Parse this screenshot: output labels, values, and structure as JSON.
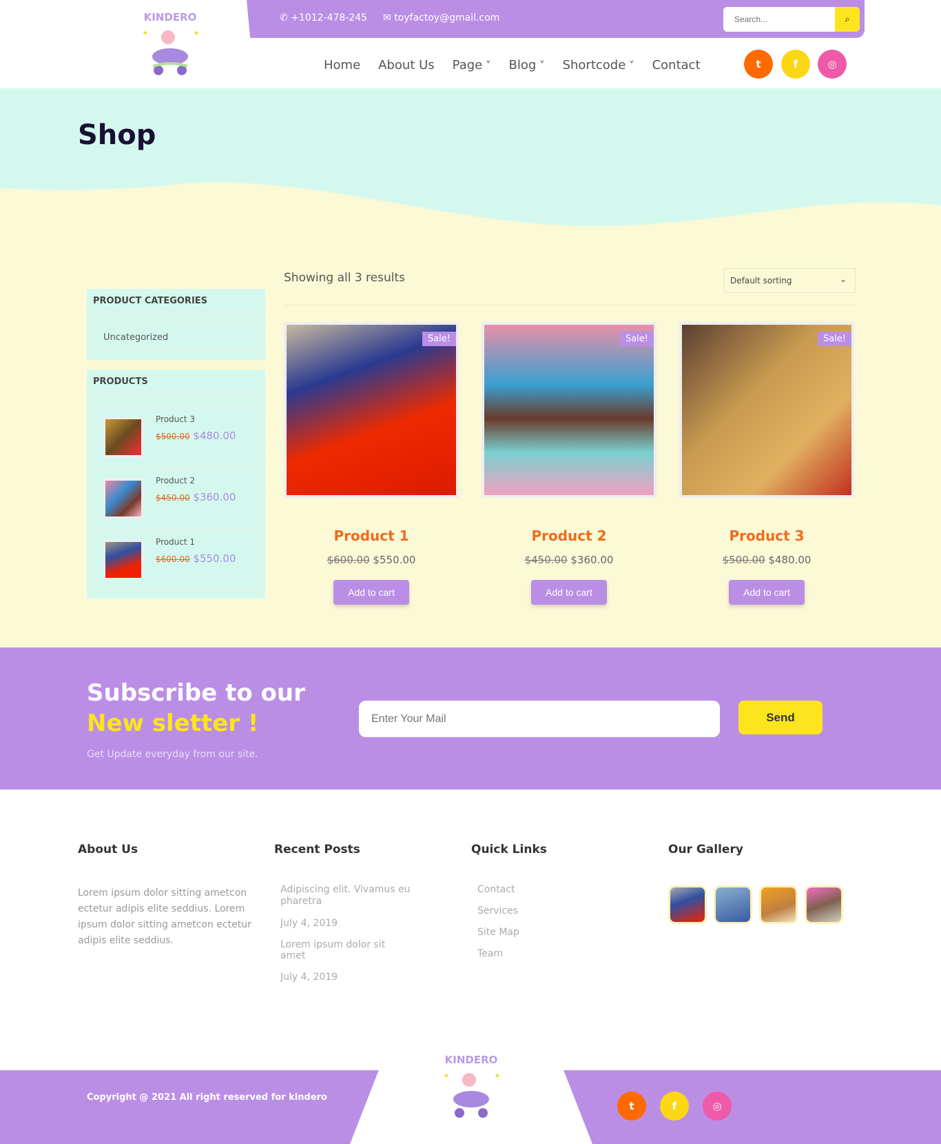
{
  "header": {
    "phone": "+1012-478-245",
    "email": "toyfactoy@gmail.com",
    "search_placeholder": "Search...",
    "logo_text": "KINDERO",
    "nav": [
      "Home",
      "About Us",
      "Page",
      "Blog",
      "Shortcode",
      "Contact"
    ],
    "social": [
      {
        "icon": "twitter-icon",
        "glyph": "t",
        "color": "#ff6a00"
      },
      {
        "icon": "facebook-icon",
        "glyph": "f",
        "color": "#fcd716"
      },
      {
        "icon": "instagram-icon",
        "glyph": "◎",
        "color": "#ee5aa8"
      }
    ]
  },
  "hero": {
    "title": "Shop"
  },
  "sidebar": {
    "categories_title": "PRODUCT CATEGORIES",
    "categories": [
      "Uncategorized"
    ],
    "products_title": "PRODUCTS",
    "products": [
      {
        "name": "Product 3",
        "old": "$500.00",
        "price": "$480.00"
      },
      {
        "name": "Product 2",
        "old": "$450.00",
        "price": "$360.00"
      },
      {
        "name": "Product 1",
        "old": "$600.00",
        "price": "$550.00"
      }
    ]
  },
  "shop": {
    "showing": "Showing all 3 results",
    "sort": "Default sorting",
    "products": [
      {
        "title": "Product 1",
        "old": "$600.00",
        "price": "$550.00",
        "badge": "Sale!",
        "button": "Add to cart"
      },
      {
        "title": "Product 2",
        "old": "$450.00",
        "price": "$360.00",
        "badge": "Sale!",
        "button": "Add to cart"
      },
      {
        "title": "Product 3",
        "old": "$500.00",
        "price": "$480.00",
        "badge": "Sale!",
        "button": "Add to cart"
      }
    ]
  },
  "newsletter": {
    "title_a": "Subscribe to our ",
    "title_b": "New sletter !",
    "sub": "Get Update everyday from our site.",
    "placeholder": "Enter Your Mail",
    "button": "Send"
  },
  "footer": {
    "about_title": "About Us",
    "about_text": "Lorem ipsum dolor sitting ametcon ectetur adipis elite seddius. Lorem ipsum dolor sitting ametcon ectetur adipis elite seddius.",
    "posts_title": "Recent Posts",
    "posts": [
      {
        "title": "Adipiscing elit. Vivamus eu pharetra",
        "date": "July 4, 2019"
      },
      {
        "title": "Lorem ipsum dolor sit amet",
        "date": "July 4, 2019"
      }
    ],
    "links_title": "Quick Links",
    "links": [
      "Contact",
      "Services",
      "Site Map",
      "Team"
    ],
    "gallery_title": "Our Gallery",
    "copyright": "Copyright @ 2021 All right reserved for kindero"
  },
  "colors": {
    "purple": "#bb8ee6",
    "mint": "#d5f8ee",
    "cream": "#fbf9d6",
    "orange": "#ef6c1a",
    "yellow": "#fce51c"
  }
}
